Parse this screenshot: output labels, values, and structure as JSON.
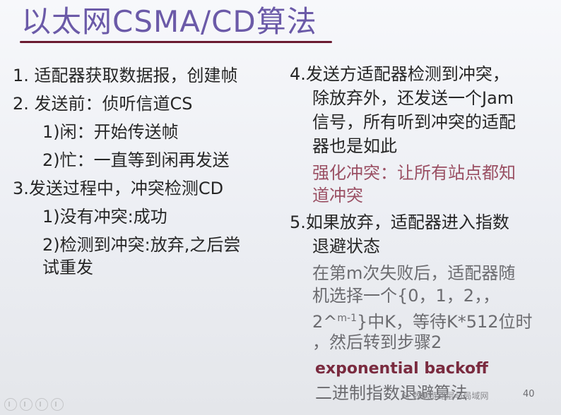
{
  "title": "以太网CSMA/CD算法",
  "left": {
    "item1": "1. 适配器获取数据报，创建帧",
    "item2": "2. 发送前：侦听信道CS",
    "item2_sub1": "1)闲：开始传送帧",
    "item2_sub2": "2)忙：一直等到闲再发送",
    "item3": "3.发送过程中，冲突检测CD",
    "item3_sub1": "1)没有冲突:成功",
    "item3_sub2_line1": "2)检测到冲突:放弃,之后尝",
    "item3_sub2_line2": "试重发"
  },
  "right": {
    "item4_line1": "4.发送方适配器检测到冲突，",
    "item4_line2": "除放弃外，还发送一个Jam",
    "item4_line3": "信号，所有听到冲突的适配",
    "item4_line4": "器也是如此",
    "item4_note_line1": "强化冲突：让所有站点都知",
    "item4_note_line2": "道冲突",
    "item5_line1": "5.如果放弃，适配器进入指数",
    "item5_line2": "退避状态",
    "item5_note_line1": "在第m次失败后，适配器随",
    "item5_note_line2": "机选择一个{0，1，2，，",
    "item5_note_line3_pre": "2^",
    "item5_note_line3_sup": "m-1",
    "item5_note_line3_post": "}中K，等待K*512位时",
    "item5_note_line4": "，然后转到步骤2",
    "exp_backoff": "exponential backoff",
    "exp_backoff_cn": "二进制指数退避算法"
  },
  "footer": {
    "text": "6: 数据链路层与局域网",
    "page": "40"
  },
  "colors": {
    "title": "#6b5aa8",
    "underline": "#6a1a30",
    "note_pink": "#9a4f63",
    "note_grey": "#6c6c70",
    "maroon": "#7a2b3f"
  }
}
